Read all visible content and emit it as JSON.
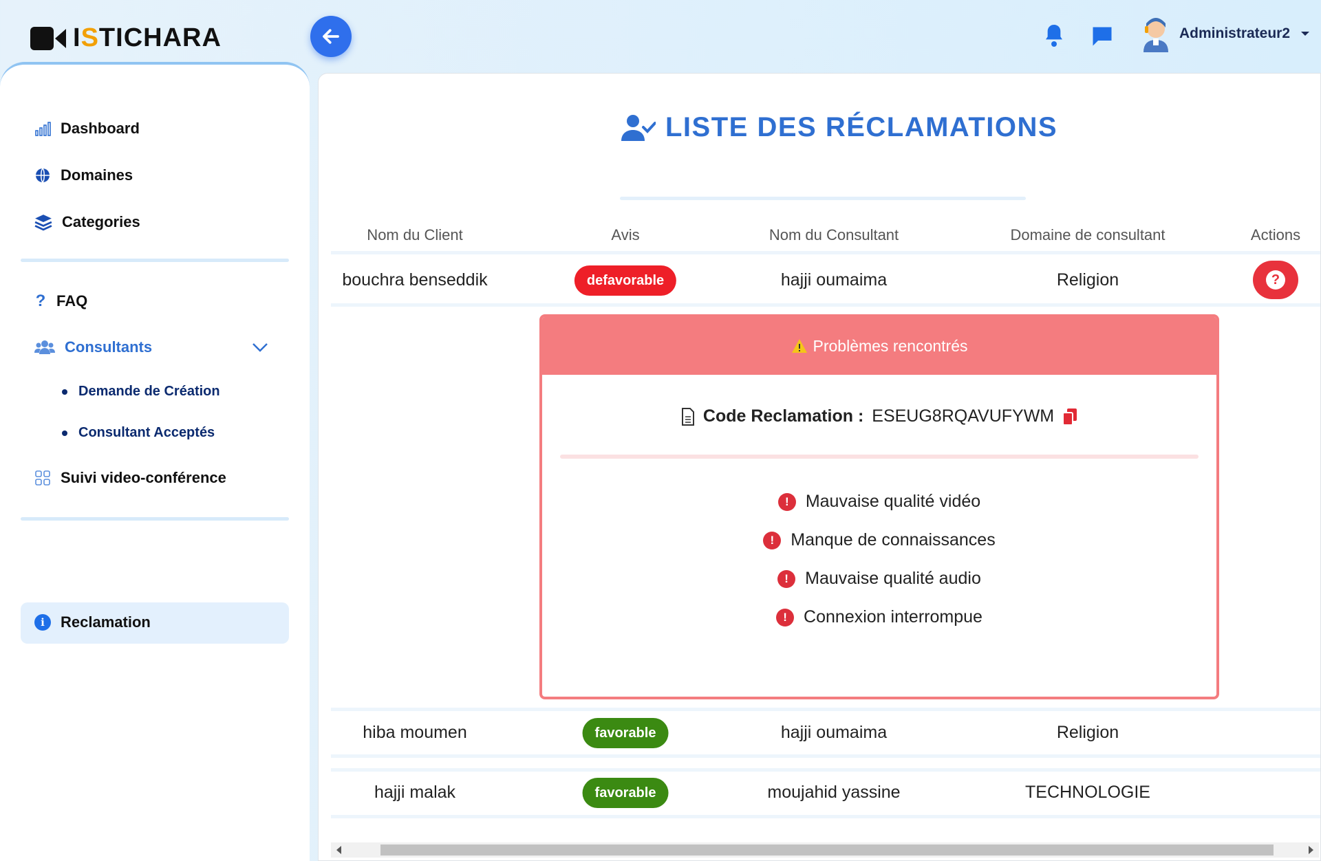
{
  "app": {
    "logo_first": "I",
    "logo_accent": "S",
    "logo_rest": "TICHARA"
  },
  "header": {
    "user_name": "Administrateur2",
    "icons": [
      "back-arrow-icon",
      "bell-icon",
      "chat-icon",
      "avatar"
    ]
  },
  "sidebar": {
    "items": [
      {
        "label": "Dashboard",
        "icon": "bar-chart-icon"
      },
      {
        "label": "Domaines",
        "icon": "globe-icon"
      },
      {
        "label": "Categories",
        "icon": "layers-icon"
      },
      {
        "label": "FAQ",
        "icon": "question-icon"
      },
      {
        "label": "Consultants",
        "icon": "users-icon"
      },
      {
        "label": "Demande de Création",
        "icon": "bullet"
      },
      {
        "label": "Consultant Acceptés",
        "icon": "bullet"
      },
      {
        "label": "Suivi video-conférence",
        "icon": "grid-icon"
      },
      {
        "label": "Reclamation",
        "icon": "info-icon"
      }
    ],
    "active": "Reclamation"
  },
  "main": {
    "title": "LISTE DES RÉCLAMATIONS",
    "columns": [
      "Nom du Client",
      "Avis",
      "Nom du Consultant",
      "Domaine de consultant",
      "Actions"
    ],
    "rows": [
      {
        "client": "bouchra benseddik",
        "avis": "defavorable",
        "consultant": "hajji oumaima",
        "domaine": "Religion"
      },
      {
        "client": "hiba moumen",
        "avis": "favorable",
        "consultant": "hajji oumaima",
        "domaine": "Religion"
      },
      {
        "client": "hajji malak",
        "avis": "favorable",
        "consultant": "moujahid yassine",
        "domaine": "TECHNOLOGIE"
      }
    ],
    "problems_card": {
      "title": "Problèmes rencontrés",
      "code_label": "Code Reclamation :",
      "code_value": "ESEUG8RQAVUFYWM",
      "problems": [
        "Mauvaise qualité vidéo",
        "Manque de connaissances",
        "Mauvaise qualité audio",
        "Connexion interrompue"
      ]
    }
  },
  "colors": {
    "primary": "#2f6fd1",
    "danger": "#ee1f28",
    "success": "#3b8a12",
    "card_header": "#f47c7f"
  }
}
